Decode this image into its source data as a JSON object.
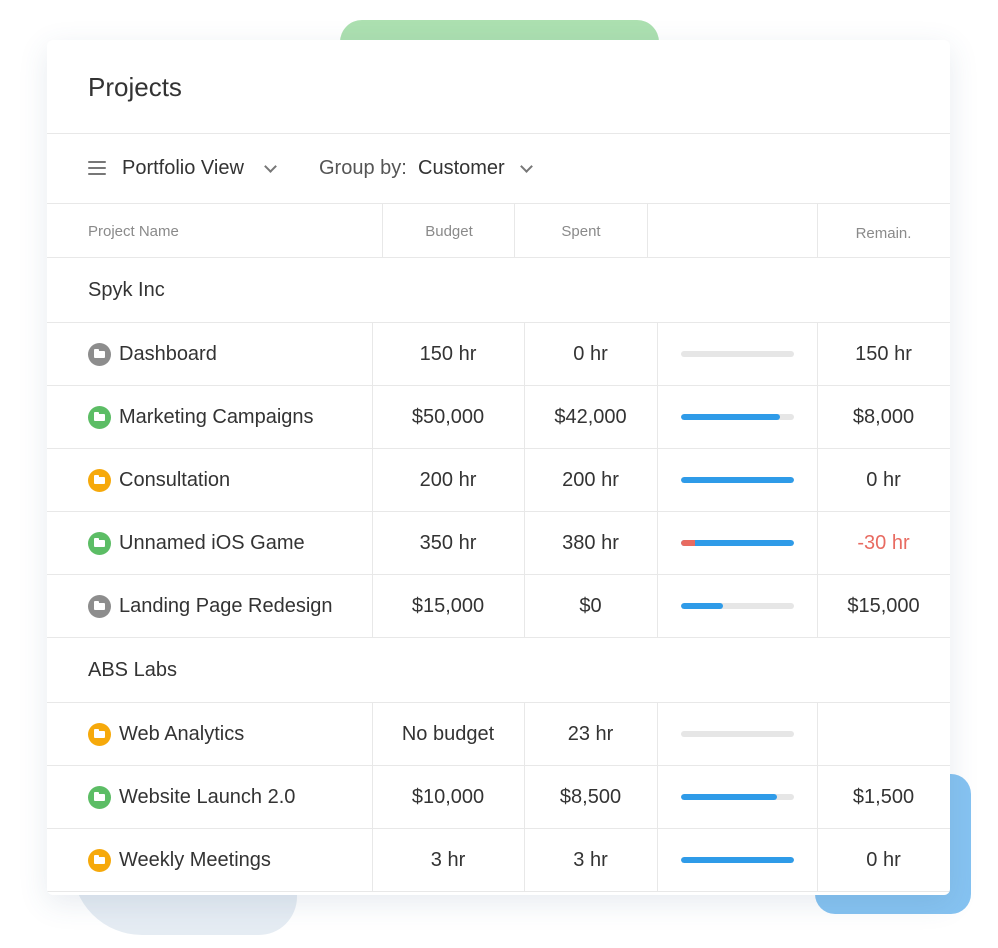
{
  "title": "Projects",
  "toolbar": {
    "view_label": "Portfolio View",
    "group_by_label": "Group by:",
    "group_by_value": "Customer"
  },
  "columns": {
    "name": "Project Name",
    "budget": "Budget",
    "spent": "Spent",
    "progress": "",
    "remaining": "Remain."
  },
  "colors": {
    "status_gray": "#8d8d8d",
    "status_green": "#5cbd65",
    "status_orange": "#f6a90b",
    "progress_blue": "#2f9be8",
    "over_budget_red": "#e86b61"
  },
  "groups": [
    {
      "name": "Spyk Inc",
      "projects": [
        {
          "name": "Dashboard",
          "status": "gray",
          "icon": "folder-icon",
          "budget": "150 hr",
          "spent": "0 hr",
          "progress": 0,
          "over": 0,
          "remaining": "150 hr",
          "remaining_negative": false
        },
        {
          "name": "Marketing Campaigns",
          "status": "green",
          "icon": "folder-icon",
          "budget": "$50,000",
          "spent": "$42,000",
          "progress": 0.88,
          "over": 0,
          "remaining": "$8,000",
          "remaining_negative": false
        },
        {
          "name": "Consultation",
          "status": "orange",
          "icon": "folder-icon",
          "budget": "200 hr",
          "spent": "200 hr",
          "progress": 1.0,
          "over": 0,
          "remaining": "0 hr",
          "remaining_negative": false
        },
        {
          "name": "Unnamed iOS Game",
          "status": "green",
          "icon": "folder-icon",
          "budget": "350 hr",
          "spent": "380 hr",
          "progress": 1.0,
          "over": 0.12,
          "remaining": "-30 hr",
          "remaining_negative": true
        },
        {
          "name": "Landing Page Redesign",
          "status": "gray",
          "icon": "folder-icon",
          "budget": "$15,000",
          "spent": "$0",
          "progress": 0.37,
          "over": 0,
          "remaining": "$15,000",
          "remaining_negative": false
        }
      ]
    },
    {
      "name": "ABS Labs",
      "projects": [
        {
          "name": "Web Analytics",
          "status": "orange",
          "icon": "folder-icon",
          "budget": "No budget",
          "spent": "23 hr",
          "progress": 0,
          "over": 0,
          "remaining": "",
          "remaining_negative": false
        },
        {
          "name": "Website Launch 2.0",
          "status": "green",
          "icon": "folder-icon",
          "budget": "$10,000",
          "spent": "$8,500",
          "progress": 0.85,
          "over": 0,
          "remaining": "$1,500",
          "remaining_negative": false
        },
        {
          "name": "Weekly Meetings",
          "status": "orange",
          "icon": "folder-icon",
          "budget": "3 hr",
          "spent": "3 hr",
          "progress": 1.0,
          "over": 0,
          "remaining": "0 hr",
          "remaining_negative": false
        }
      ]
    }
  ]
}
